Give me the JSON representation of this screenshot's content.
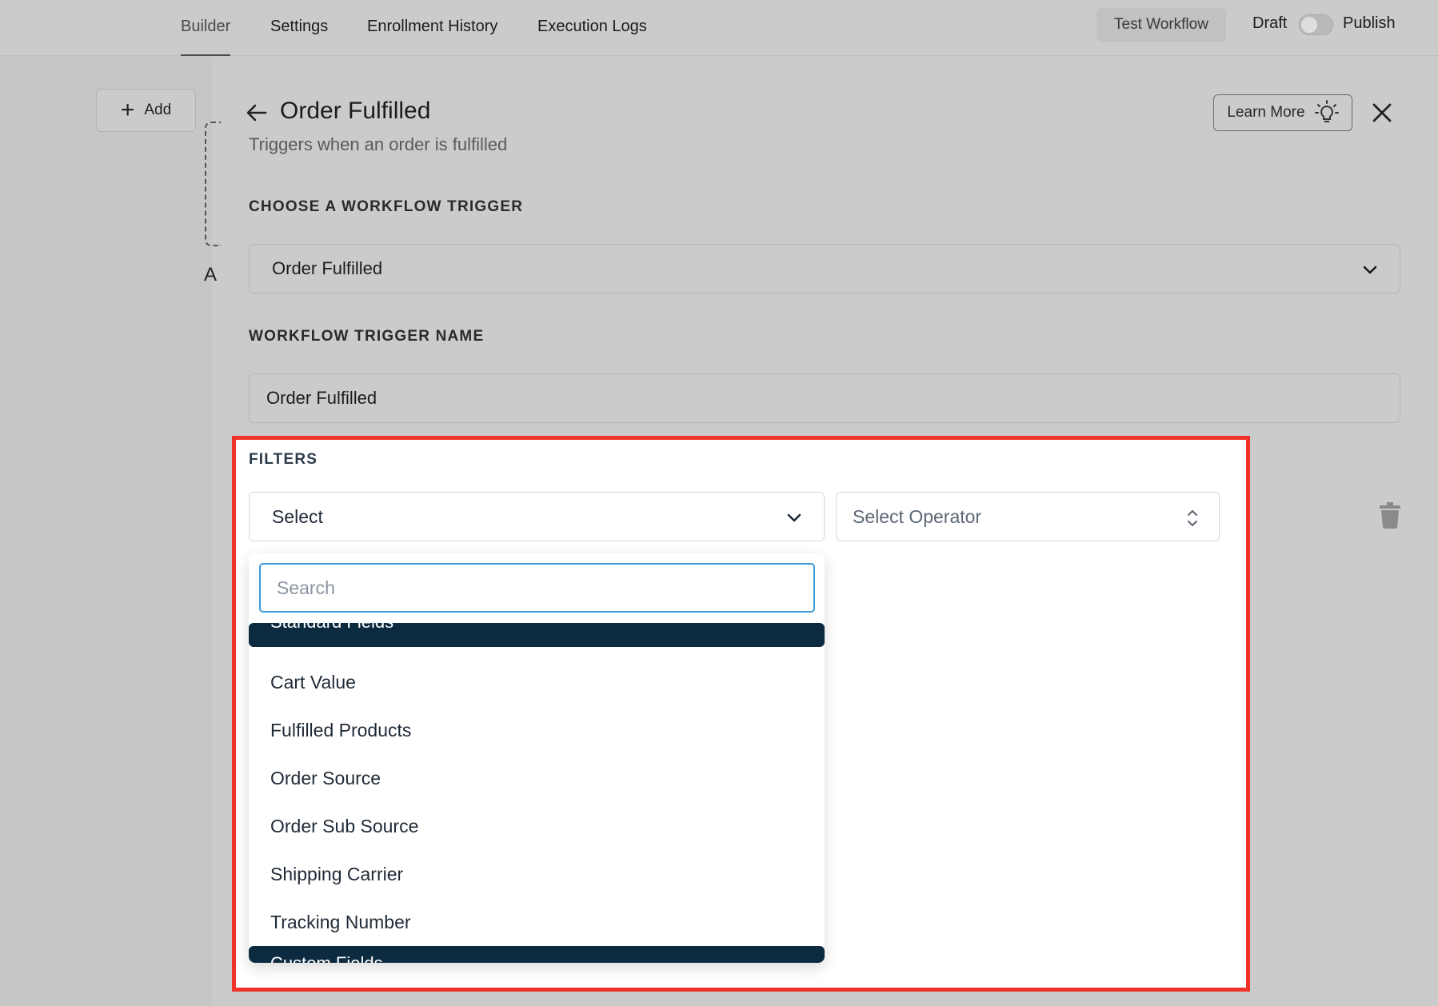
{
  "nav": {
    "tabs": [
      "Builder",
      "Settings",
      "Enrollment History",
      "Execution Logs"
    ],
    "active_tab": "Builder",
    "test_button": "Test Workflow",
    "draft_label": "Draft",
    "publish_label": "Publish"
  },
  "canvas": {
    "add_label": "Add",
    "truncated_label": "A"
  },
  "panel": {
    "title": "Order Fulfilled",
    "subtitle": "Triggers when an order is fulfilled",
    "learn_more": "Learn More",
    "trigger_section_label": "CHOOSE A WORKFLOW TRIGGER",
    "trigger_value": "Order Fulfilled",
    "name_section_label": "WORKFLOW TRIGGER NAME",
    "name_value": "Order Fulfilled"
  },
  "filters": {
    "label": "FILTERS",
    "field_select_value": "Select",
    "operator_placeholder": "Select Operator",
    "dropdown": {
      "search_placeholder": "Search",
      "group_standard": "Standard Fields",
      "options": [
        "Cart Value",
        "Fulfilled Products",
        "Order Source",
        "Order Sub Source",
        "Shipping Carrier",
        "Tracking Number"
      ],
      "group_custom": "Custom Fields"
    }
  },
  "colors": {
    "highlight_border": "#f0332a",
    "group_header_bg": "#0d2b40",
    "search_focus": "#3b9bd8"
  }
}
